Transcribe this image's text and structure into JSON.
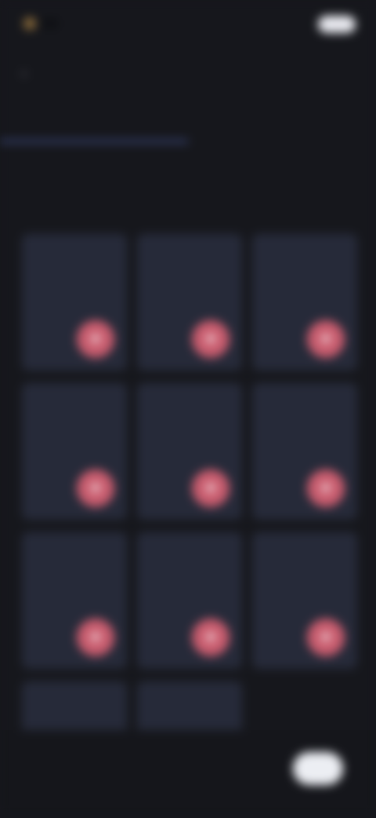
{
  "status_bar": {
    "logo_text": "",
    "time": ""
  },
  "header": {
    "title": ""
  },
  "tabs": [
    {
      "label": ""
    },
    {
      "label": ""
    }
  ],
  "section": {
    "title": "",
    "subtitle": ""
  },
  "cards": [
    {
      "name": "",
      "meta": "",
      "action": "+"
    },
    {
      "name": "",
      "meta": "",
      "action": "+"
    },
    {
      "name": "",
      "meta": "",
      "action": "+"
    },
    {
      "name": "",
      "meta": "",
      "action": "+"
    },
    {
      "name": "",
      "meta": "",
      "action": "+"
    },
    {
      "name": "",
      "meta": "",
      "action": "+"
    },
    {
      "name": "",
      "meta": "",
      "action": "+"
    },
    {
      "name": "",
      "meta": "",
      "action": "+"
    },
    {
      "name": "",
      "meta": "",
      "action": "+"
    },
    {
      "name": "",
      "meta": ""
    },
    {
      "name": "",
      "meta": ""
    }
  ],
  "footer": {
    "note": "",
    "button_label": ""
  },
  "colors": {
    "background": "#16171c",
    "card": "#262a39",
    "accent": "#7a8ad8",
    "action": "#c95c6e"
  },
  "icons": {
    "back": "back-arrow-icon",
    "logo": "logo-icon",
    "add": "add-icon"
  }
}
